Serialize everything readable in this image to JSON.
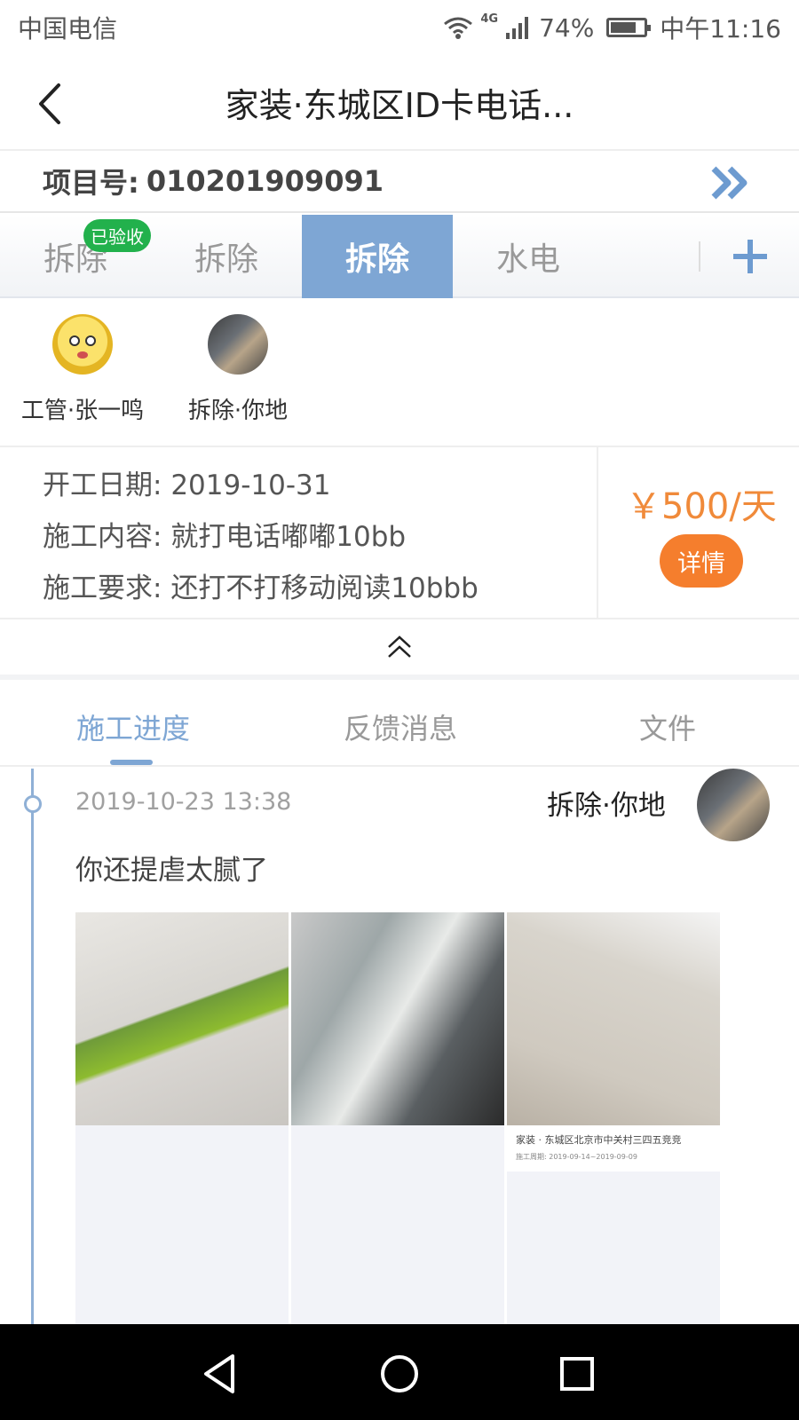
{
  "status_bar": {
    "carrier": "中国电信",
    "network": "4G",
    "battery": "74%",
    "time": "中午11:16"
  },
  "header": {
    "title": "家装·东城区ID卡电话..."
  },
  "project": {
    "label": "项目号:",
    "number": "010201909091"
  },
  "tabs": [
    {
      "label": "拆除",
      "badge": "已验收"
    },
    {
      "label": "拆除"
    },
    {
      "label": "拆除",
      "active": true
    },
    {
      "label": "水电"
    }
  ],
  "members": [
    {
      "name": "工管·张一鸣"
    },
    {
      "name": "拆除·你地"
    }
  ],
  "info": {
    "start_date_label": "开工日期:",
    "start_date": "2019-10-31",
    "content_label": "施工内容:",
    "content": "就打电话嘟嘟10bb",
    "requirement_label": "施工要求:",
    "requirement": "还打不打移动阅读10bbb",
    "price": "￥500/天",
    "detail_button": "详情"
  },
  "sub_tabs": [
    {
      "label": "施工进度",
      "active": true
    },
    {
      "label": "反馈消息"
    },
    {
      "label": "文件"
    }
  ],
  "entry": {
    "time": "2019-10-23 13:38",
    "author": "拆除·你地",
    "text": "你还提虐太腻了",
    "caption_location": "家装 · 东城区北京市中关村三四五竞竞",
    "caption_period": "施工周期: 2019-09-14~2019-09-09"
  },
  "colors": {
    "accent_blue": "#7ea6d4",
    "orange": "#f57e2d",
    "badge_green": "#22b14c"
  }
}
